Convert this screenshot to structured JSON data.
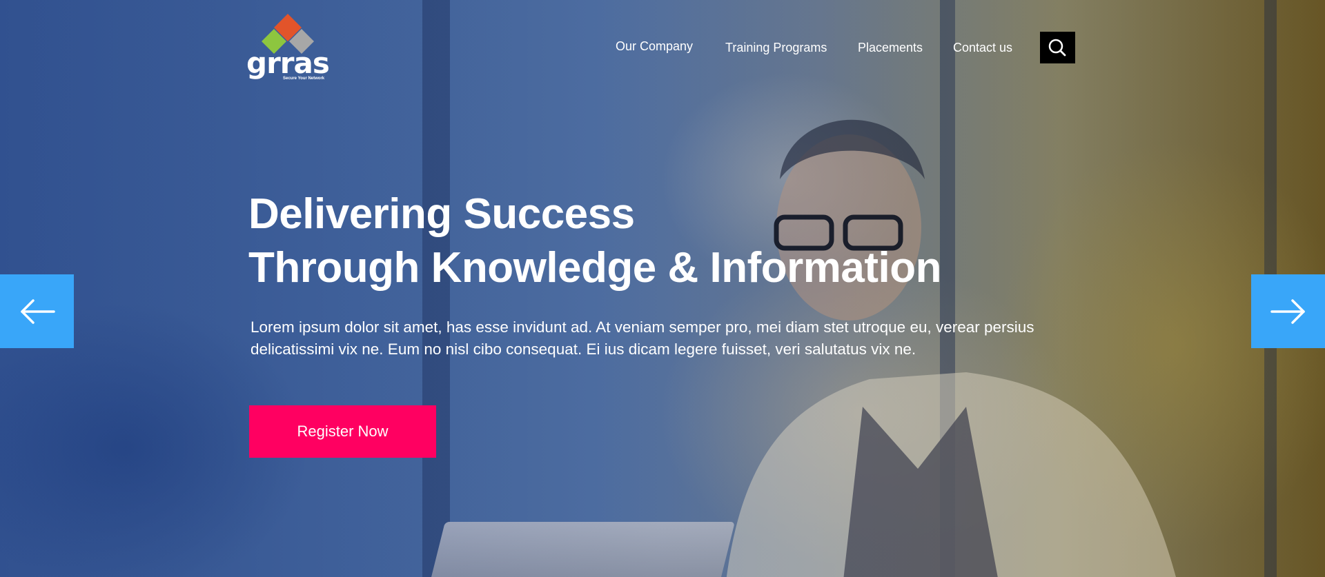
{
  "brand": {
    "name": "grras",
    "tagline": "Secure Your Network",
    "logo_colors": [
      "#e2542a",
      "#8dc63f",
      "#9e9e9e"
    ]
  },
  "nav": {
    "items": [
      {
        "label": "Our Company"
      },
      {
        "label": "Training Programs"
      },
      {
        "label": "Placements"
      },
      {
        "label": "Contact us"
      }
    ],
    "search_icon": "search-icon"
  },
  "hero": {
    "headline_line1": "Delivering Success",
    "headline_line2": "Through Knowledge & Information",
    "body": "Lorem ipsum dolor sit amet, has esse invidunt ad. At veniam semper pro, mei diam stet utroque eu, verear persius delicatissimi vix ne. Eum no nisl cibo consequat. Ei ius dicam legere fuisset, veri salutatus vix ne.",
    "cta_label": "Register Now",
    "prev_icon": "arrow-left-icon",
    "next_icon": "arrow-right-icon"
  },
  "colors": {
    "cta": "#ff0061",
    "arrow_button": "#39a6f9",
    "search_button": "#000000",
    "text": "#ffffff"
  }
}
